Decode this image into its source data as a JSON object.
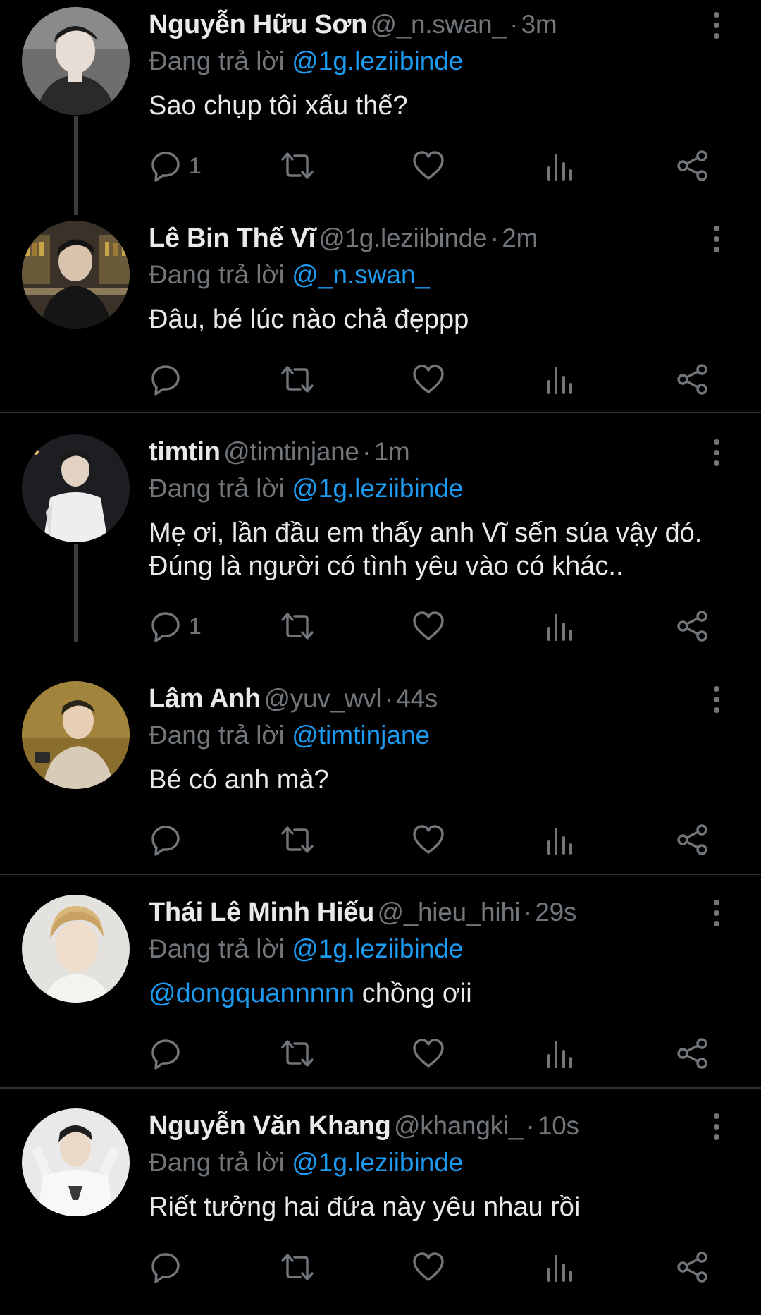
{
  "replying_prefix": "Đang trả lời",
  "separator": "·",
  "tweets": [
    {
      "name": "Nguyễn Hữu Sơn",
      "handle": "@_n.swan_",
      "time": "3m",
      "replying_to": "@1g.leziibinde",
      "mention": "",
      "text": "Sao chụp tôi xấu thế?",
      "reply_count": "1",
      "avatar_icon": "profile-photo"
    },
    {
      "name": "Lê Bin Thế Vĩ",
      "handle": "@1g.leziibinde",
      "time": "2m",
      "replying_to": "@_n.swan_",
      "mention": "",
      "text": "Đâu, bé lúc nào chả đẹppp",
      "reply_count": "",
      "avatar_icon": "profile-photo"
    },
    {
      "name": "timtin",
      "handle": "@timtinjane",
      "time": "1m",
      "replying_to": "@1g.leziibinde",
      "mention": "",
      "text": "Mẹ ơi, lần đầu em thấy anh Vĩ sến súa vậy đó. Đúng là người có tình yêu vào có khác..",
      "reply_count": "1",
      "avatar_icon": "profile-photo"
    },
    {
      "name": "Lâm Anh",
      "handle": "@yuv_wvl",
      "time": "44s",
      "replying_to": "@timtinjane",
      "mention": "",
      "text": "Bé có anh mà?",
      "reply_count": "",
      "avatar_icon": "profile-photo"
    },
    {
      "name": "Thái Lê Minh Hiếu",
      "handle": "@_hieu_hihi",
      "time": "29s",
      "replying_to": "@1g.leziibinde",
      "mention": "@dongquannnnn",
      "text": " chồng ơii",
      "reply_count": "",
      "avatar_icon": "profile-photo"
    },
    {
      "name": "Nguyễn Văn Khang",
      "handle": "@khangki_",
      "time": "10s",
      "replying_to": "@1g.leziibinde",
      "mention": "",
      "text": "Riết tưởng hai đứa này yêu nhau rồi",
      "reply_count": "",
      "avatar_icon": "profile-photo"
    }
  ],
  "icons": {
    "reply": "reply-icon",
    "retweet": "retweet-icon",
    "like": "heart-icon",
    "views": "views-icon",
    "share": "share-icon",
    "more": "more-vertical-icon"
  },
  "colors": {
    "background": "#000000",
    "text": "#e7e9ea",
    "secondary": "#71767b",
    "link": "#1d9bf0",
    "divider": "#2f3336",
    "thread_line": "#3a3d40"
  }
}
